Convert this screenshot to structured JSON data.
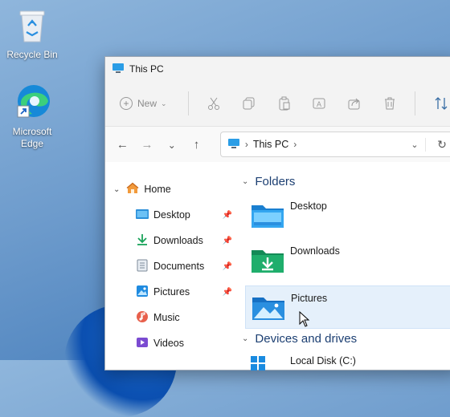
{
  "desktop": {
    "icons": [
      {
        "label": "Recycle Bin",
        "icon": "recycle-bin-icon"
      },
      {
        "label": "Microsoft Edge",
        "icon": "edge-icon"
      }
    ]
  },
  "window": {
    "title": "This PC",
    "command_bar": {
      "new_label": "New",
      "tools": [
        "cut-icon",
        "copy-icon",
        "paste-icon",
        "rename-icon",
        "share-icon",
        "delete-icon",
        "sort-icon"
      ]
    },
    "address": {
      "location": "This PC"
    },
    "sidebar": {
      "home": "Home",
      "items": [
        {
          "label": "Desktop",
          "icon": "desktop-folder-icon",
          "pinned": true
        },
        {
          "label": "Downloads",
          "icon": "download-icon",
          "pinned": true
        },
        {
          "label": "Documents",
          "icon": "documents-icon",
          "pinned": true
        },
        {
          "label": "Pictures",
          "icon": "pictures-icon",
          "pinned": true
        },
        {
          "label": "Music",
          "icon": "music-icon",
          "pinned": false
        },
        {
          "label": "Videos",
          "icon": "videos-icon",
          "pinned": false
        }
      ]
    },
    "content": {
      "folders_header": "Folders",
      "folders": [
        {
          "name": "Desktop",
          "selected": false
        },
        {
          "name": "Downloads",
          "selected": false
        },
        {
          "name": "Pictures",
          "selected": true
        }
      ],
      "drives_header": "Devices and drives",
      "drives": [
        {
          "name": "Local Disk (C:)"
        }
      ]
    }
  },
  "colors": {
    "accent": "#0067c0",
    "selection": "#e5f0fb",
    "folder": "#2a8fe0"
  }
}
